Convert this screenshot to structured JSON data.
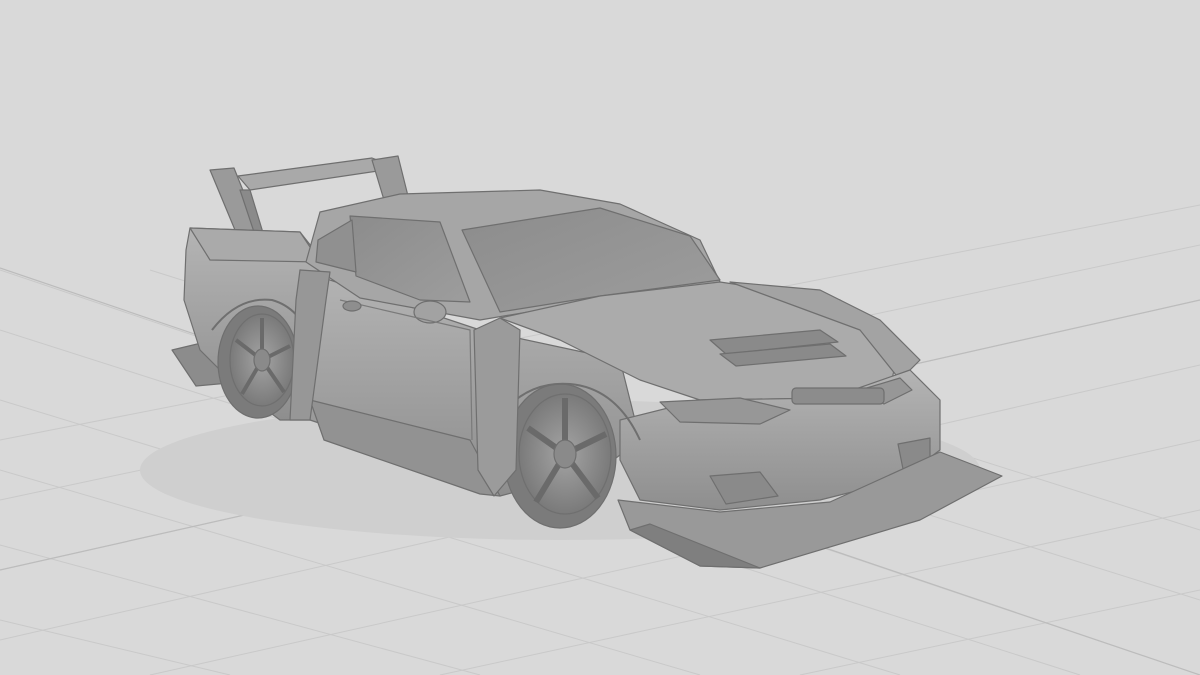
{
  "scene": {
    "background_color": "#d9d9d9",
    "grid_color": "#c9c9c9",
    "grid_axis_color": "#bdbdbd",
    "model_color": "#9c9c9c",
    "model_shadow_color": "#7d7d7d",
    "model_highlight_color": "#b3b3b3",
    "render_mode": "solid-viewport",
    "subject": "widebody-sports-coupe-clay-model"
  }
}
